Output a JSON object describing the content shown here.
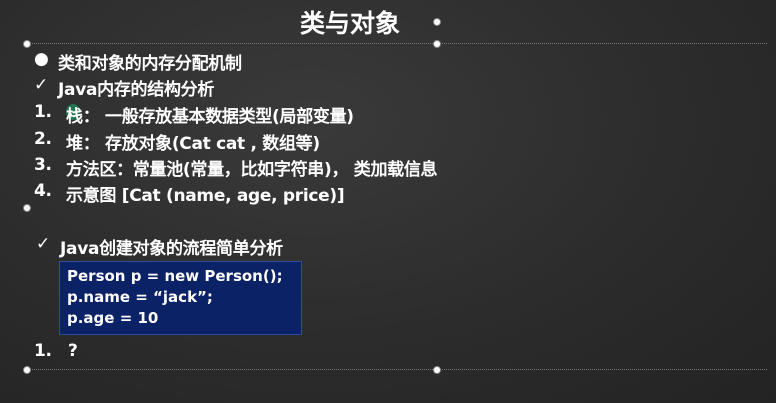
{
  "slide": {
    "title": "类与对象",
    "bullet_main": "类和对象的内存分配机制",
    "section1_title": "Java内存的结构分析",
    "items": [
      {
        "num": "1.",
        "text": "栈： 一般存放基本数据类型(局部变量)"
      },
      {
        "num": "2.",
        "text": "堆： 存放对象(Cat cat , 数组等)"
      },
      {
        "num": "3.",
        "text": "方法区：常量池(常量，比如字符串)， 类加载信息"
      },
      {
        "num": "4.",
        "text": "示意图 [Cat (name, age, price)]"
      }
    ],
    "section2_title": "Java创建对象的流程简单分析",
    "code_lines": [
      "Person p = new Person();",
      "p.name = “jack”;",
      "p.age = 10"
    ],
    "question_num": "1.",
    "question_text": "?",
    "bullet_icon": "filled-circle-icon",
    "check_icon": "checkmark-icon"
  }
}
